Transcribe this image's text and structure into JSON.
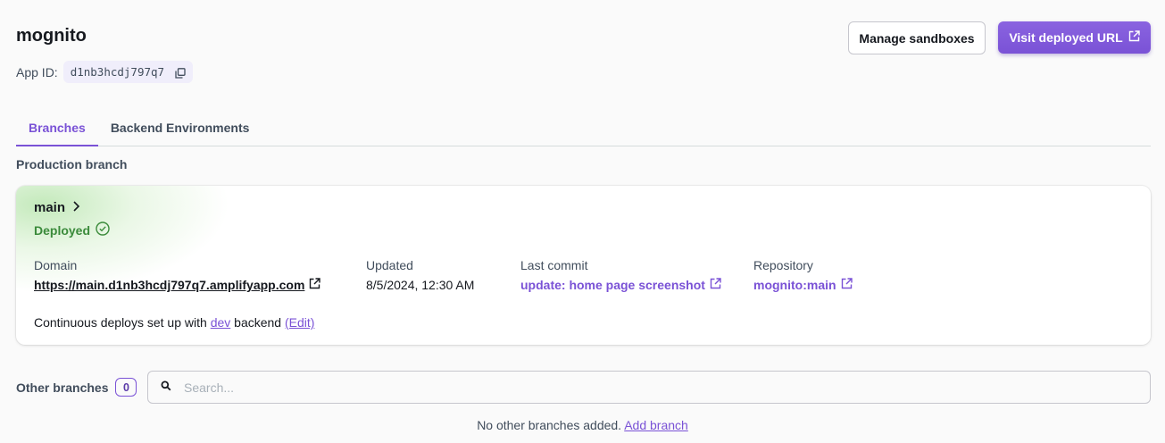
{
  "app": {
    "title": "mognito",
    "id_label": "App ID:",
    "id_value": "d1nb3hcdj797q7"
  },
  "header_actions": {
    "manage_label": "Manage sandboxes",
    "visit_label": "Visit deployed URL"
  },
  "tabs": [
    {
      "label": "Branches",
      "active": true
    },
    {
      "label": "Backend Environments",
      "active": false
    }
  ],
  "production": {
    "section_label": "Production branch",
    "branch_name": "main",
    "status": "Deployed",
    "domain_label": "Domain",
    "domain_value": "https://main.d1nb3hcdj797q7.amplifyapp.com",
    "updated_label": "Updated",
    "updated_value": "8/5/2024, 12:30 AM",
    "commit_label": "Last commit",
    "commit_value": "update: home page screenshot",
    "repo_label": "Repository",
    "repo_value": "mognito:main",
    "note_prefix": "Continuous deploys set up with",
    "note_backend": "dev",
    "note_suffix": "backend",
    "note_edit": "(Edit)"
  },
  "other": {
    "label": "Other branches",
    "count": "0",
    "search_placeholder": "Search...",
    "empty_text": "No other branches added.",
    "add_link": "Add branch"
  },
  "colors": {
    "accent": "#7a52d6",
    "success": "#3b8b3b",
    "text": "#16191f"
  },
  "icons": {
    "copy": "copy-icon",
    "external": "external-link-icon",
    "chevron": "chevron-right-icon",
    "status": "check-circle-icon",
    "search": "search-icon"
  }
}
